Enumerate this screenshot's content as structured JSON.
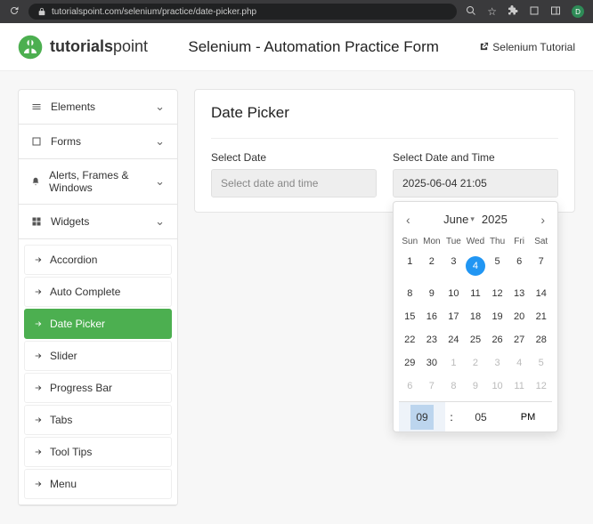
{
  "browser": {
    "url": "tutorialspoint.com/selenium/practice/date-picker.php"
  },
  "header": {
    "brand_prefix": "tutorials",
    "brand_suffix": "point",
    "title": "Selenium - Automation Practice Form",
    "tutorial_link": "Selenium Tutorial"
  },
  "sidebar": {
    "sections": {
      "elements": "Elements",
      "forms": "Forms",
      "alerts": "Alerts, Frames & Windows",
      "widgets": "Widgets"
    },
    "widget_items": {
      "accordion": "Accordion",
      "autocomplete": "Auto Complete",
      "datepicker": "Date Picker",
      "slider": "Slider",
      "progress": "Progress Bar",
      "tabs": "Tabs",
      "tooltips": "Tool Tips",
      "menu": "Menu"
    }
  },
  "main": {
    "heading": "Date Picker",
    "select_date_label": "Select Date",
    "select_date_placeholder": "Select date and time",
    "select_datetime_label": "Select Date and Time",
    "select_datetime_value": "2025-06-04 21:05"
  },
  "calendar": {
    "month": "June",
    "year": "2025",
    "dow": [
      "Sun",
      "Mon",
      "Tue",
      "Wed",
      "Thu",
      "Fri",
      "Sat"
    ],
    "weeks": [
      [
        {
          "d": "1"
        },
        {
          "d": "2"
        },
        {
          "d": "3"
        },
        {
          "d": "4",
          "sel": true
        },
        {
          "d": "5"
        },
        {
          "d": "6"
        },
        {
          "d": "7"
        }
      ],
      [
        {
          "d": "8"
        },
        {
          "d": "9"
        },
        {
          "d": "10"
        },
        {
          "d": "11"
        },
        {
          "d": "12"
        },
        {
          "d": "13"
        },
        {
          "d": "14"
        }
      ],
      [
        {
          "d": "15"
        },
        {
          "d": "16"
        },
        {
          "d": "17"
        },
        {
          "d": "18"
        },
        {
          "d": "19"
        },
        {
          "d": "20"
        },
        {
          "d": "21"
        }
      ],
      [
        {
          "d": "22"
        },
        {
          "d": "23"
        },
        {
          "d": "24"
        },
        {
          "d": "25"
        },
        {
          "d": "26"
        },
        {
          "d": "27"
        },
        {
          "d": "28"
        }
      ],
      [
        {
          "d": "29"
        },
        {
          "d": "30"
        },
        {
          "d": "1",
          "out": true
        },
        {
          "d": "2",
          "out": true
        },
        {
          "d": "3",
          "out": true
        },
        {
          "d": "4",
          "out": true
        },
        {
          "d": "5",
          "out": true
        }
      ],
      [
        {
          "d": "6",
          "out": true
        },
        {
          "d": "7",
          "out": true
        },
        {
          "d": "8",
          "out": true
        },
        {
          "d": "9",
          "out": true
        },
        {
          "d": "10",
          "out": true
        },
        {
          "d": "11",
          "out": true
        },
        {
          "d": "12",
          "out": true
        }
      ]
    ],
    "time": {
      "hour": "09",
      "minute": "05",
      "ampm": "PM"
    }
  }
}
